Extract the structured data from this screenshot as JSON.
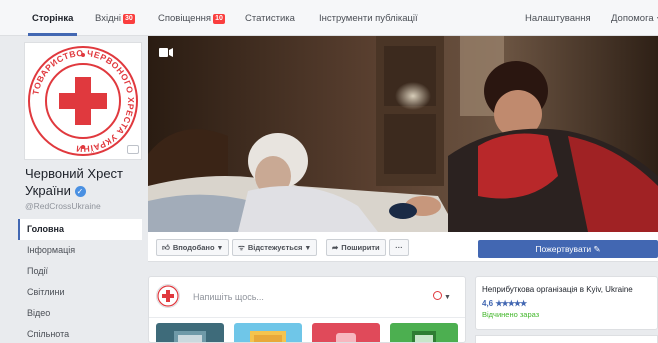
{
  "topnav": {
    "items": [
      {
        "label": "Сторінка",
        "active": true
      },
      {
        "label": "Вхідні",
        "badge": "30"
      },
      {
        "label": "Сповіщення",
        "badge": "10"
      },
      {
        "label": "Статистика"
      },
      {
        "label": "Інструменти публікації"
      },
      {
        "label": "Налаштування"
      },
      {
        "label": "Допомога"
      }
    ]
  },
  "page": {
    "name": "Червоний Хрест України",
    "handle": "@RedCrossUkraine",
    "logo_text": "ТОВАРИСТВО ЧЕРВОНОГО ХРЕСТА УКРАЇНИ"
  },
  "leftnav": {
    "items": [
      "Головна",
      "Інформація",
      "Події",
      "Світлини",
      "Відео",
      "Спільнота"
    ]
  },
  "actions": {
    "like": "Вподобано",
    "follow": "Відстежується",
    "share": "Поширити",
    "more": "···",
    "donate": "Пожертвувати"
  },
  "composer": {
    "placeholder": "Напишіть щось..."
  },
  "info": {
    "category": "Неприбуткова організація в Kyiv, Ukraine",
    "rating": "4,6",
    "stars": "★★★★★",
    "open_status": "Відчинено зараз"
  },
  "colors": {
    "brand": "#4267b2",
    "red_cross": "#e0393e",
    "badge": "#fa3e3e",
    "open_green": "#42b72a"
  }
}
